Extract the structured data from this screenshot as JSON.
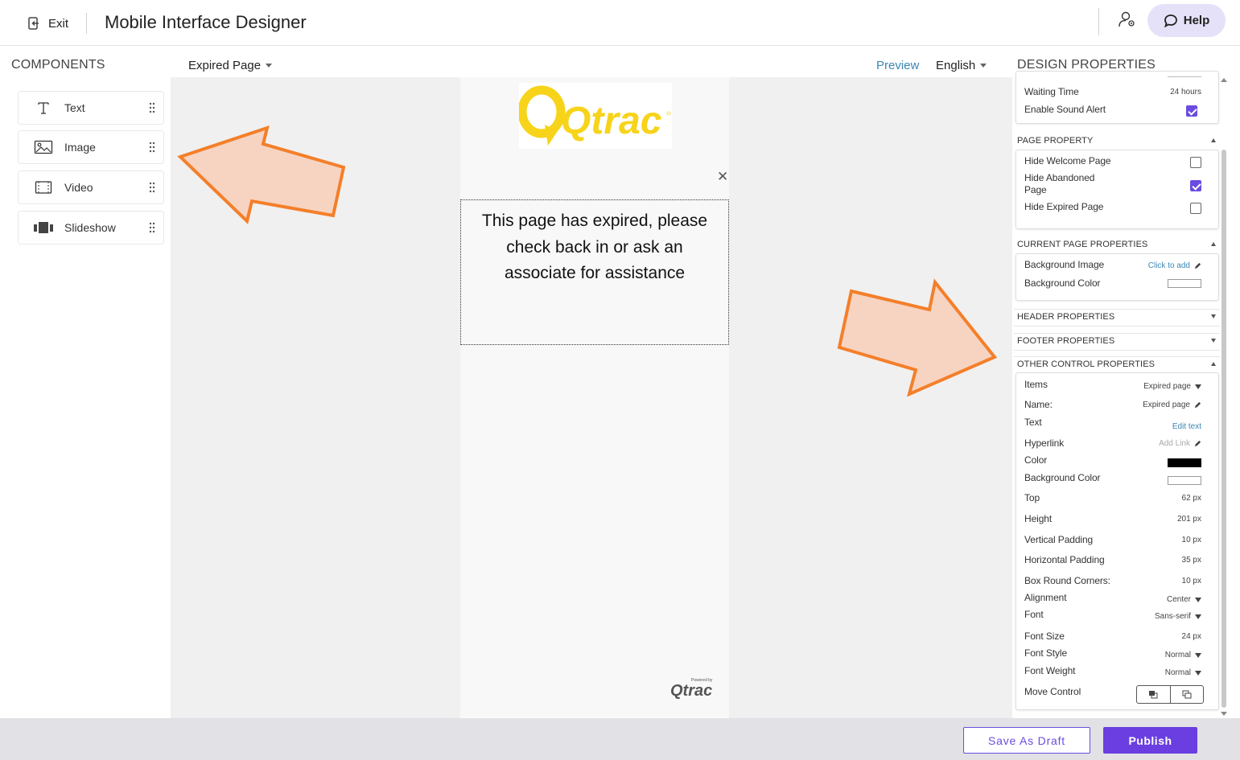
{
  "header": {
    "exit_label": "Exit",
    "title": "Mobile Interface Designer",
    "help_label": "Help"
  },
  "components": {
    "heading": "COMPONENTS",
    "items": [
      {
        "label": "Text",
        "icon": "text-icon"
      },
      {
        "label": "Image",
        "icon": "image-icon"
      },
      {
        "label": "Video",
        "icon": "video-icon"
      },
      {
        "label": "Slideshow",
        "icon": "slideshow-icon"
      }
    ]
  },
  "toolbar": {
    "page_select": "Expired Page",
    "preview_label": "Preview",
    "language": "English"
  },
  "canvas": {
    "logo_text": "Qtrac",
    "message": "This page has expired, please check back in or ask an associate for assistance",
    "powered_by": "Powered by",
    "powered_logo": "Qtrac"
  },
  "design": {
    "heading": "DESIGN PROPERTIES",
    "top_card": {
      "waiting_time_label": "Waiting Time",
      "waiting_time_value": "24 hours",
      "sound_alert_label": "Enable Sound Alert",
      "sound_alert_checked": true
    },
    "page_property": {
      "title": "PAGE PROPERTY",
      "hide_welcome_label": "Hide Welcome Page",
      "hide_welcome_checked": false,
      "hide_abandoned_label_1": "Hide Abandoned",
      "hide_abandoned_label_2": "Page",
      "hide_abandoned_checked": true,
      "hide_expired_label": "Hide Expired Page",
      "hide_expired_checked": false
    },
    "current_page": {
      "title": "CURRENT PAGE PROPERTIES",
      "bg_image_label": "Background Image",
      "bg_image_value": "Click to add",
      "bg_color_label": "Background Color",
      "bg_color_value": "#ffffff"
    },
    "header_props_title": "HEADER PROPERTIES",
    "footer_props_title": "FOOTER PROPERTIES",
    "other": {
      "title": "OTHER CONTROL PROPERTIES",
      "items_label": "Items",
      "items_value": "Expired page",
      "name_label": "Name:",
      "name_value": "Expired page",
      "text_label": "Text",
      "text_value": "Edit text",
      "hyperlink_label": "Hyperlink",
      "hyperlink_value": "Add Link",
      "color_label": "Color",
      "color_value": "#000000",
      "bg_color_label": "Background Color",
      "bg_color_value": "#ffffff",
      "top_label": "Top",
      "top_value": "62 px",
      "height_label": "Height",
      "height_value": "201 px",
      "vpad_label": "Vertical Padding",
      "vpad_value": "10 px",
      "hpad_label": "Horizontal Padding",
      "hpad_value": "35 px",
      "corners_label": "Box Round Corners:",
      "corners_value": "10 px",
      "align_label": "Alignment",
      "align_value": "Center",
      "font_label": "Font",
      "font_value": "Sans-serif",
      "font_size_label": "Font Size",
      "font_size_value": "24 px",
      "font_style_label": "Font Style",
      "font_style_value": "Normal",
      "font_weight_label": "Font Weight",
      "font_weight_value": "Normal",
      "move_label": "Move Control"
    }
  },
  "footer": {
    "draft_label": "Save As Draft",
    "publish_label": "Publish"
  },
  "colors": {
    "accent": "#6a4ce0",
    "link": "#3b86b5",
    "annotation_arrow_fill": "#f7d4c2",
    "annotation_arrow_stroke": "#f47f2a",
    "logo_yellow": "#f7d31a"
  }
}
